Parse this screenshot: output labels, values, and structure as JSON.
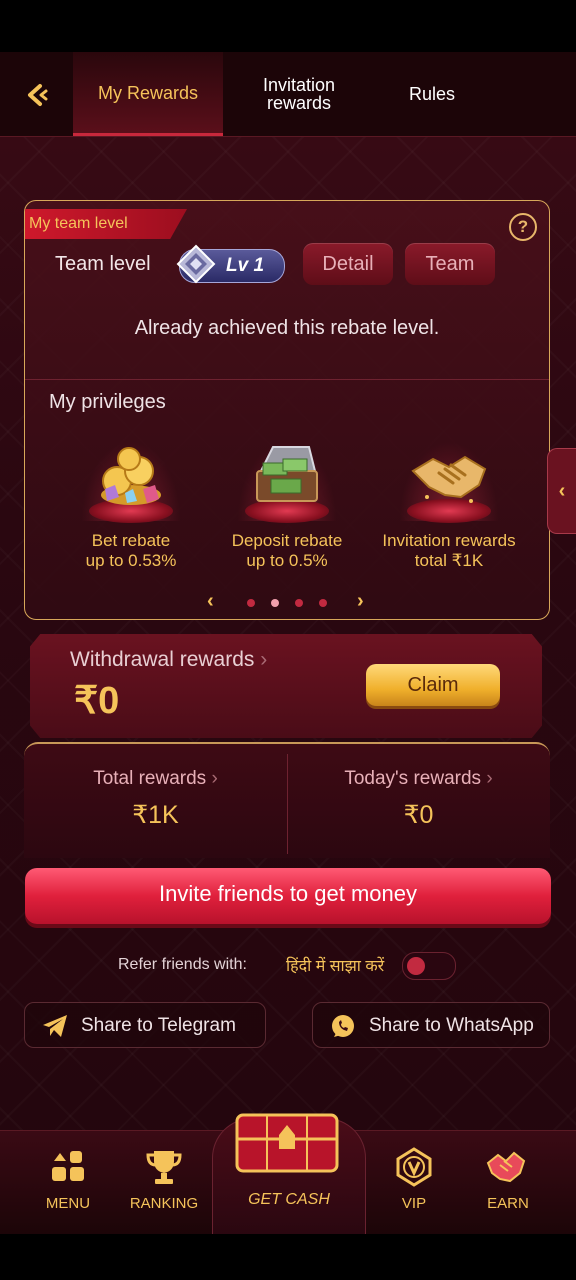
{
  "header": {
    "back_icon": "back-arrow-icon",
    "tabs": [
      {
        "label": "My Rewards",
        "active": true
      },
      {
        "label": "Invitation rewards",
        "active": false
      },
      {
        "label": "Rules",
        "active": false
      }
    ]
  },
  "team_card": {
    "ribbon": "My team level",
    "help_icon": "question-icon",
    "team_level_label": "Team level",
    "level_badge": "Lv 1",
    "detail_button": "Detail",
    "team_button": "Team",
    "achieved_text": "Already achieved this rebate level.",
    "privileges_title": "My privileges",
    "privileges": [
      {
        "title": "Bet rebate",
        "value": "up to 0.53%",
        "icon": "coins-gems-icon"
      },
      {
        "title": "Deposit rebate",
        "value": "up to 0.5%",
        "icon": "money-chest-icon"
      },
      {
        "title": "Invitation rewards",
        "value": "total ₹1K",
        "icon": "handshake-icon"
      }
    ],
    "pager": {
      "count": 4,
      "active_index": 1
    }
  },
  "withdrawal": {
    "label": "Withdrawal rewards",
    "value": "₹0",
    "claim_button": "Claim"
  },
  "totals": {
    "total_label": "Total rewards",
    "total_value": "₹1K",
    "today_label": "Today's rewards",
    "today_value": "₹0"
  },
  "invite_button": "Invite friends to get money",
  "refer": {
    "label": "Refer friends with:",
    "option": "हिंदी में साझा करें",
    "toggle_on": false
  },
  "share": {
    "telegram": "Share to Telegram",
    "whatsapp": "Share to WhatsApp"
  },
  "nav": {
    "menu": "MENU",
    "ranking": "RANKING",
    "get_cash": "GET CASH",
    "vip": "VIP",
    "earn": "EARN"
  },
  "colors": {
    "accent_gold": "#f5c35a",
    "primary_red": "#e0203c",
    "background": "#2a0710"
  }
}
